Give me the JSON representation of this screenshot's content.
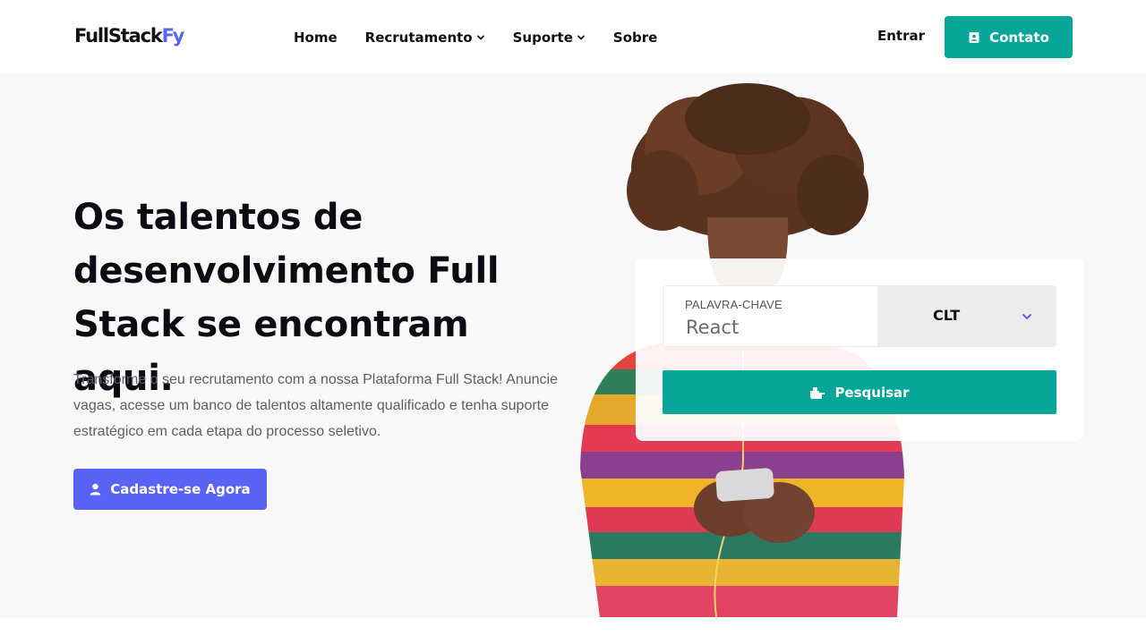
{
  "header": {
    "logo_main": "FullStack",
    "logo_accent": "Fy",
    "nav": [
      {
        "label": "Home",
        "dropdown": false
      },
      {
        "label": "Recrutamento",
        "dropdown": true
      },
      {
        "label": "Suporte",
        "dropdown": true
      },
      {
        "label": "Sobre",
        "dropdown": false
      }
    ],
    "login_label": "Entrar",
    "contact_label": "Contato"
  },
  "hero": {
    "title": "Os talentos de desenvolvimento Full Stack se encontram aqui.",
    "description": "Transforme o seu recrutamento com a nossa Plataforma Full Stack! Anuncie vagas, acesse um banco de talentos altamente qualificado e tenha suporte estratégico em cada etapa do processo seletivo.",
    "cta_label": "Cadastre-se Agora"
  },
  "search": {
    "keyword_label": "PALAVRA-CHAVE",
    "keyword_value": "React",
    "type_value": "CLT",
    "submit_label": "Pesquisar"
  },
  "colors": {
    "brand_teal": "#07a698",
    "brand_purple": "#5b63f6",
    "hero_bg": "#f8f8f8"
  },
  "icons": {
    "contact": "address-card-icon",
    "cta": "user-icon",
    "search": "hand-pointer-icon",
    "dropdown": "chevron-down-icon"
  }
}
